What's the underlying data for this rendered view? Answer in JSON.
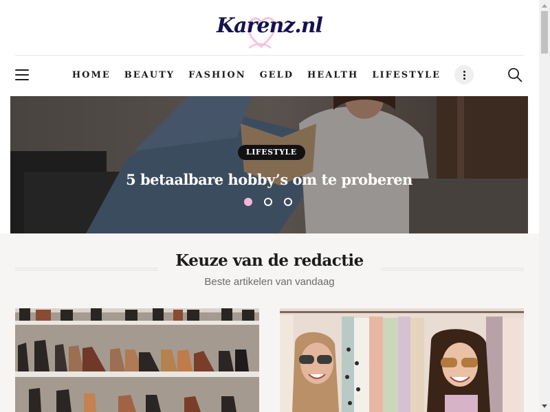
{
  "site": {
    "logo_text": "Karenz.nl",
    "accent_color": "#f3b6d8",
    "logo_color": "#16124f"
  },
  "nav": {
    "menu_icon": "hamburger-icon",
    "items": [
      "Home",
      "Beauty",
      "Fashion",
      "Geld",
      "Health",
      "Lifestyle"
    ],
    "more_icon": "more-vertical-icon",
    "search_icon": "search-icon"
  },
  "slider": {
    "category": "Lifestyle",
    "title": "5 betaalbare hobby’s om te proberen",
    "slide_count": 3,
    "active_slide": 1
  },
  "editors_pick": {
    "title": "Keuze van de redactie",
    "subtitle": "Beste artikelen van vandaag"
  },
  "scrollbar": {
    "up_icon": "scroll-up-arrow-icon",
    "down_icon": "scroll-down-arrow-icon"
  }
}
